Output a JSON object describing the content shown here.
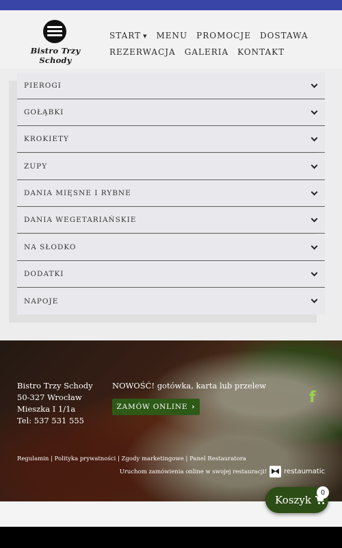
{
  "brand": {
    "name": "Bistro Trzy Schody"
  },
  "nav": {
    "row1": [
      "START",
      "MENU",
      "PROMOCJE",
      "DOSTAWA"
    ],
    "row2": [
      "REZERWACJA",
      "GALERIA",
      "KONTAKT"
    ]
  },
  "menu_categories": [
    "PIEROGI",
    "GOŁĄBKI",
    "KROKIETY",
    "ZUPY",
    "DANIA MIĘSNE I RYBNE",
    "DANIA WEGETARIAŃSKIE",
    "NA SŁODKO",
    "DODATKI",
    "NAPOJE"
  ],
  "footer": {
    "address": [
      "Bistro Trzy Schody",
      "50-327 Wrocław",
      "Mieszka I 1/1a",
      "Tel: 537 531 555"
    ],
    "news": "NOWOŚĆ! gotówka, karta lub przelew",
    "order_button": "ZAMÓW ONLINE",
    "links": [
      "Regulamin",
      "Polityka prywatności",
      "Zgody marketingowe",
      "Panel Restauratora"
    ],
    "powered_text": "Uruchom zamówienia online w swojej restauracji!",
    "powered_brand": "restaumatic",
    "social_icon": "facebook-icon"
  },
  "cart": {
    "label": "Koszyk",
    "count": "0"
  },
  "colors": {
    "topbar": "#3a45a8",
    "accent_green": "#2e5a18",
    "facebook": "#9bd14a"
  }
}
